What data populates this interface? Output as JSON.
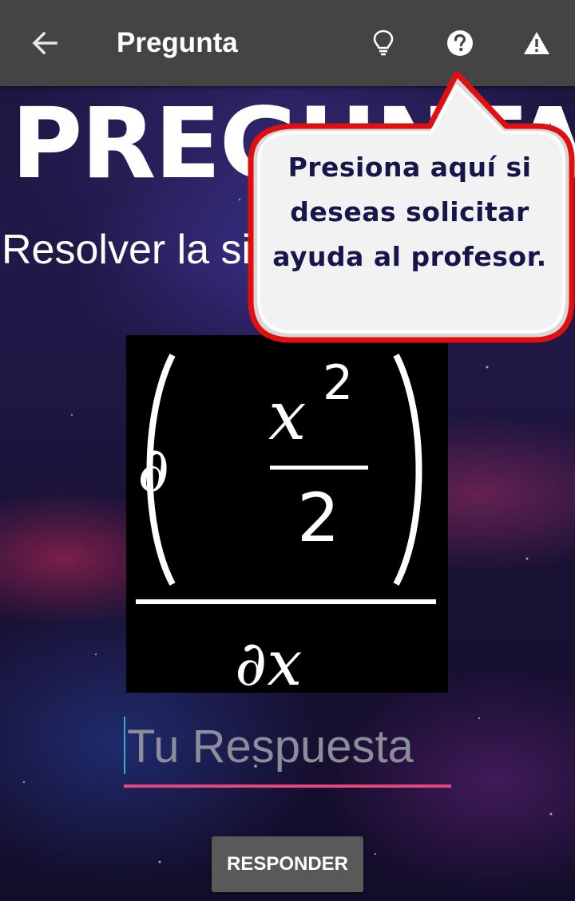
{
  "app_bar": {
    "title": "Pregunta",
    "back_icon": "arrow-left-icon",
    "hint_icon": "lightbulb-icon",
    "help_icon": "question-circle-icon",
    "report_icon": "warning-triangle-icon",
    "background_color": "#444444"
  },
  "banner": {
    "text": "PREGUNTA"
  },
  "question": {
    "prompt": "Resolver la siguiente derivada",
    "formula": {
      "partial": "∂",
      "numerator_var": "x",
      "exponent": "2",
      "denominator_const": "2",
      "differential": "∂x"
    }
  },
  "answer": {
    "placeholder": "Tu Respuesta",
    "value": "",
    "underline_color": "#e8457a"
  },
  "submit": {
    "label": "RESPONDER"
  },
  "callout": {
    "text": "Presiona aquí  si deseas solicitar ayuda al profesor.",
    "border_color": "#e01010"
  }
}
